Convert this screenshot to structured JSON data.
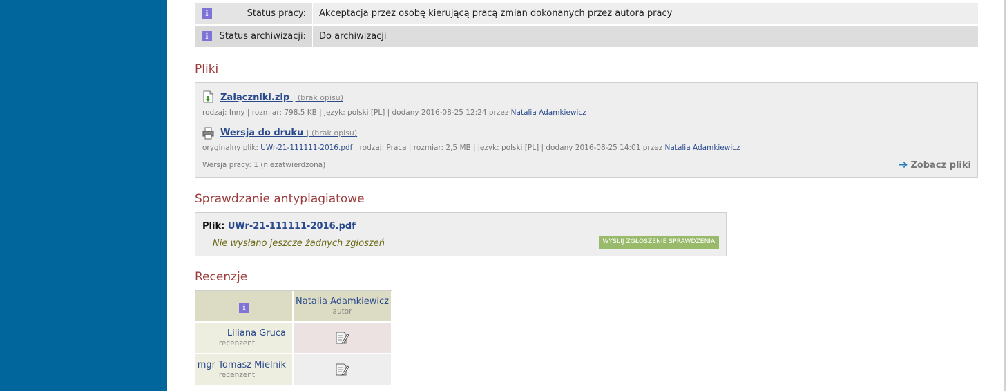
{
  "status": [
    {
      "label": "Status pracy:",
      "value": "Akceptacja przez osobę kierującą pracą zmian dokonanych przez autora pracy"
    },
    {
      "label": "Status archiwizacji:",
      "value": "Do archiwizacji"
    }
  ],
  "files": {
    "heading": "Pliki",
    "items": [
      {
        "name": "Załączniki.zip",
        "desc": "| (brak opisu)",
        "meta_prefix": "rodzaj: Inny | rozmiar: 798,5 KB | język: polski [PL] | dodany 2016-08-25 12:24 przez ",
        "author": "Natalia Adamkiewicz",
        "icon": "zip-download-icon"
      },
      {
        "name": "Wersja do druku",
        "desc": "| (brak opisu)",
        "meta_label": "oryginalny plik: ",
        "original_file": "UWr-21-111111-2016.pdf",
        "meta_rest": " | rodzaj: Praca | rozmiar: 2,5 MB | język: polski [PL] | dodany 2016-08-25 14:01 przez ",
        "author": "Natalia Adamkiewicz",
        "icon": "printer-icon"
      }
    ],
    "version": "Wersja pracy: 1 (niezatwierdzona)",
    "see_files": "Zobacz pliki"
  },
  "plagiarism": {
    "heading": "Sprawdzanie antyplagiatowe",
    "file_label": "Plik:",
    "file_name": "UWr-21-111111-2016.pdf",
    "note": "Nie wysłano jeszcze żadnych zgłoszeń",
    "send_button": "WYŚLIJ ZGŁOSZENIE SPRAWDZENIA"
  },
  "reviews": {
    "heading": "Recenzje",
    "author": {
      "name": "Natalia Adamkiewicz",
      "role": "autor"
    },
    "reviewers": [
      {
        "name": "Liliana Gruca",
        "role": "recenzent"
      },
      {
        "name": "mgr Tomasz Mielnik",
        "role": "recenzent"
      }
    ]
  },
  "colors": {
    "sidebar": "#00669b",
    "heading": "#9c3d3d",
    "link": "#2a4a8c",
    "button": "#98ba6a"
  }
}
